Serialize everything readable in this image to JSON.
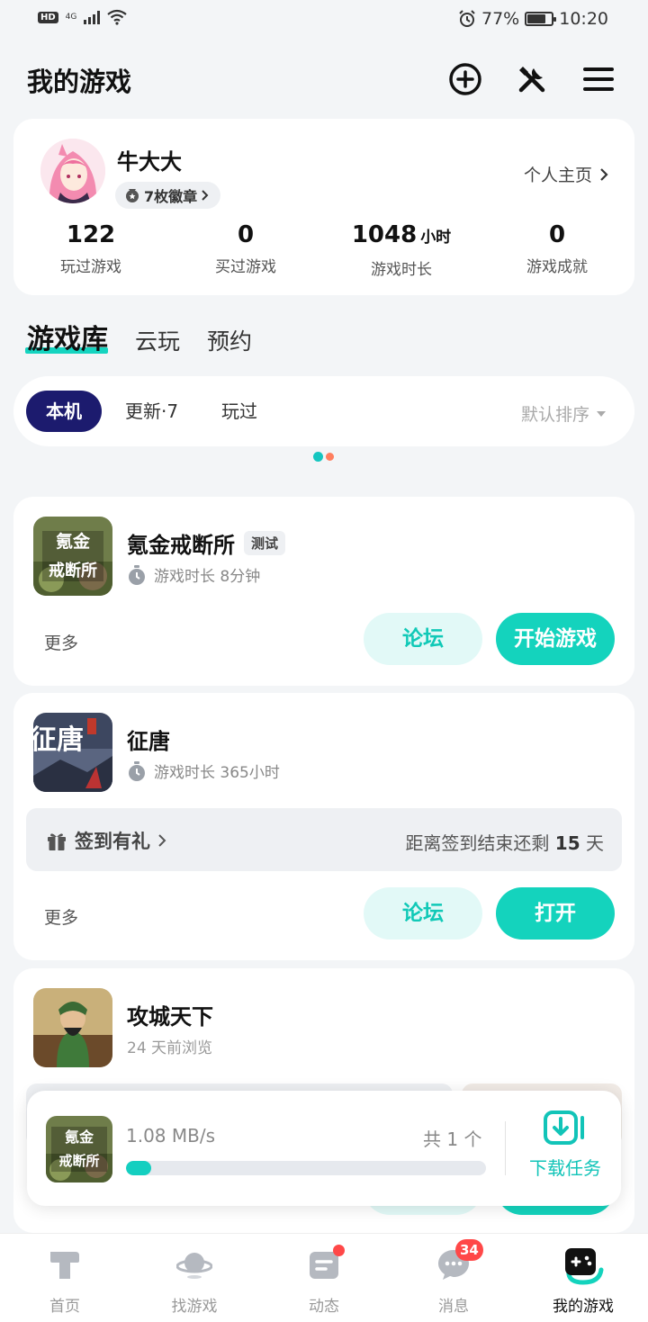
{
  "status_bar": {
    "hd": "HD",
    "network": "4G",
    "battery_percent": "77%",
    "battery_level": 0.77,
    "time": "10:20"
  },
  "header": {
    "title": "我的游戏",
    "icons": [
      "add-circle-icon",
      "tools-icon",
      "menu-icon"
    ]
  },
  "profile": {
    "username": "牛大大",
    "badge_label": "7枚徽章",
    "profile_link": "个人主页",
    "stats": [
      {
        "value": "122",
        "unit": "",
        "label": "玩过游戏"
      },
      {
        "value": "0",
        "unit": "",
        "label": "买过游戏"
      },
      {
        "value": "1048",
        "unit": "小时",
        "label": "游戏时长"
      },
      {
        "value": "0",
        "unit": "",
        "label": "游戏成就"
      }
    ]
  },
  "library_tabs": [
    "游戏库",
    "云玩",
    "预约"
  ],
  "filters": {
    "chips": [
      "本机",
      "更新·7",
      "玩过"
    ],
    "sort_label": "默认排序"
  },
  "games": [
    {
      "name": "氪金戒断所",
      "tag": "测试",
      "icon_text": [
        "氪金",
        "戒断所"
      ],
      "playtime": "游戏时长 8分钟",
      "more": "更多",
      "forum_label": "论坛",
      "primary_label": "开始游戏"
    },
    {
      "name": "征唐",
      "icon_text": "征唐",
      "playtime": "游戏时长 365小时",
      "signin_label": "签到有礼",
      "signin_prefix": "距离签到结束还剩",
      "signin_days": "15",
      "signin_suffix": "天",
      "more": "更多",
      "forum_label": "论坛",
      "primary_label": "打开"
    },
    {
      "name": "攻城天下",
      "browsed": "24 天前浏览"
    }
  ],
  "download": {
    "icon_text": [
      "氪金",
      "戒断所"
    ],
    "speed": "1.08 MB/s",
    "count": "共 1 个",
    "progress": 0.07,
    "task_label": "下载任务"
  },
  "bottom_nav": [
    {
      "label": "首页",
      "icon": "home-icon"
    },
    {
      "label": "找游戏",
      "icon": "planet-icon"
    },
    {
      "label": "动态",
      "icon": "feed-icon",
      "dot": true
    },
    {
      "label": "消息",
      "icon": "chat-icon",
      "badge": "34"
    },
    {
      "label": "我的游戏",
      "icon": "gamepad-icon",
      "active": true
    }
  ],
  "colors": {
    "accent": "#14d3bd",
    "active_chip": "#1c1b6e",
    "badge_red": "#ff4848"
  }
}
